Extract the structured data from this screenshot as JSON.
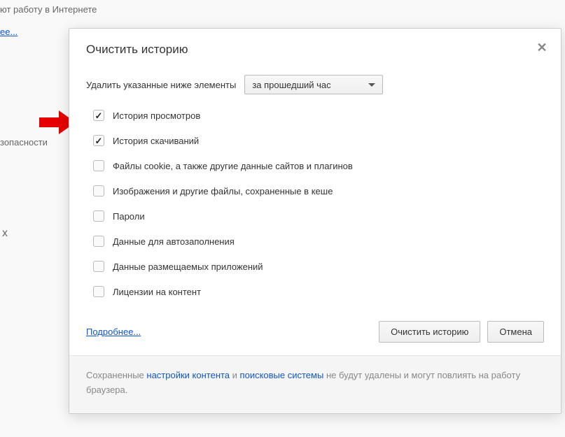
{
  "background": {
    "line1": "ют работу в Интернете",
    "link1": "ее...",
    "line2": "зопасности",
    "line3": "х"
  },
  "dialog": {
    "title": "Очистить историю",
    "timeLabel": "Удалить указанные ниже элементы",
    "dropdownValue": "за прошедший час",
    "checks": [
      {
        "label": "История просмотров",
        "checked": true
      },
      {
        "label": "История скачиваний",
        "checked": true
      },
      {
        "label": "Файлы cookie, а также другие данные сайтов и плагинов",
        "checked": false
      },
      {
        "label": "Изображения и другие файлы, сохраненные в кеше",
        "checked": false
      },
      {
        "label": "Пароли",
        "checked": false
      },
      {
        "label": "Данные для автозаполнения",
        "checked": false
      },
      {
        "label": "Данные размещаемых приложений",
        "checked": false
      },
      {
        "label": "Лицензии на контент",
        "checked": false
      }
    ],
    "moreLink": "Подробнее...",
    "clearBtn": "Очистить историю",
    "cancelBtn": "Отмена",
    "footer": {
      "t1": "Сохраненные ",
      "l1": "настройки контента",
      "t2": " и ",
      "l2": "поисковые системы",
      "t3": " не будут удалены и могут повлиять на работу браузера."
    }
  }
}
